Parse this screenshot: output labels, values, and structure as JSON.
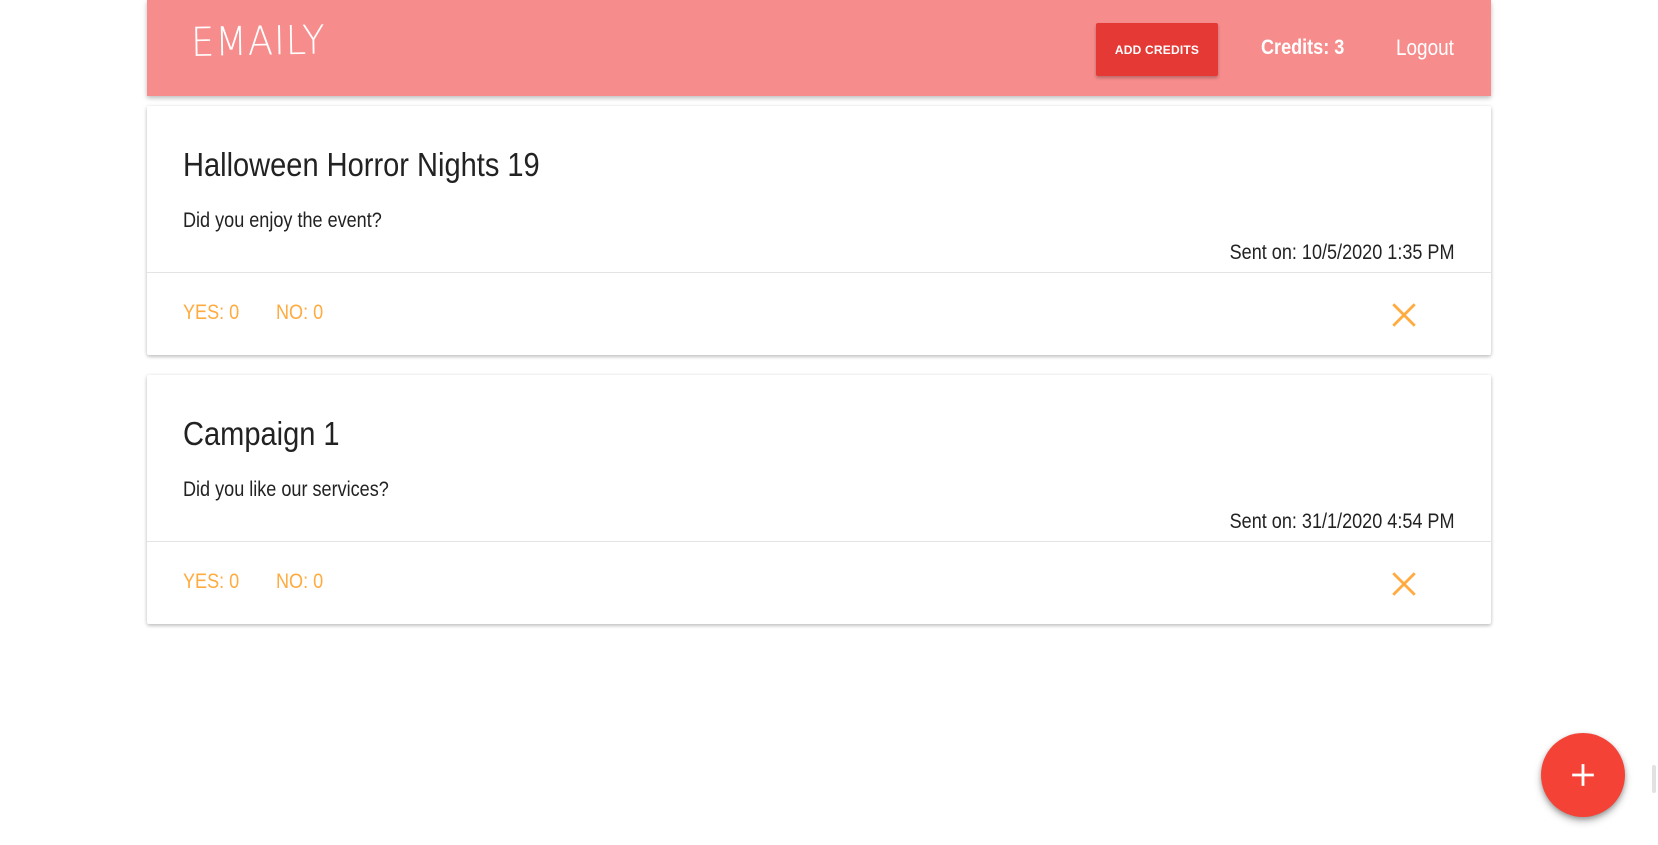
{
  "nav": {
    "logo": "EMAILY",
    "add_credits_label": "ADD CREDITS",
    "credits_text": "Credits: 3",
    "logout_label": "Logout"
  },
  "surveys": [
    {
      "title": "Halloween Horror Nights 19",
      "question": "Did you enjoy the event?",
      "sent_on": "Sent on: 10/5/2020 1:35 PM",
      "yes": "YES: 0",
      "no": "NO: 0",
      "delete_icon": "close-icon"
    },
    {
      "title": "Campaign 1",
      "question": "Did you like our services?",
      "sent_on": "Sent on: 31/1/2020 4:54 PM",
      "yes": "YES: 0",
      "no": "NO: 0",
      "delete_icon": "close-icon"
    }
  ],
  "fab": {
    "icon": "plus-icon"
  },
  "colors": {
    "navbar": "#f78c8c",
    "add_credits_button": "#e53935",
    "accent": "#ffab40",
    "fab": "#f44336"
  }
}
